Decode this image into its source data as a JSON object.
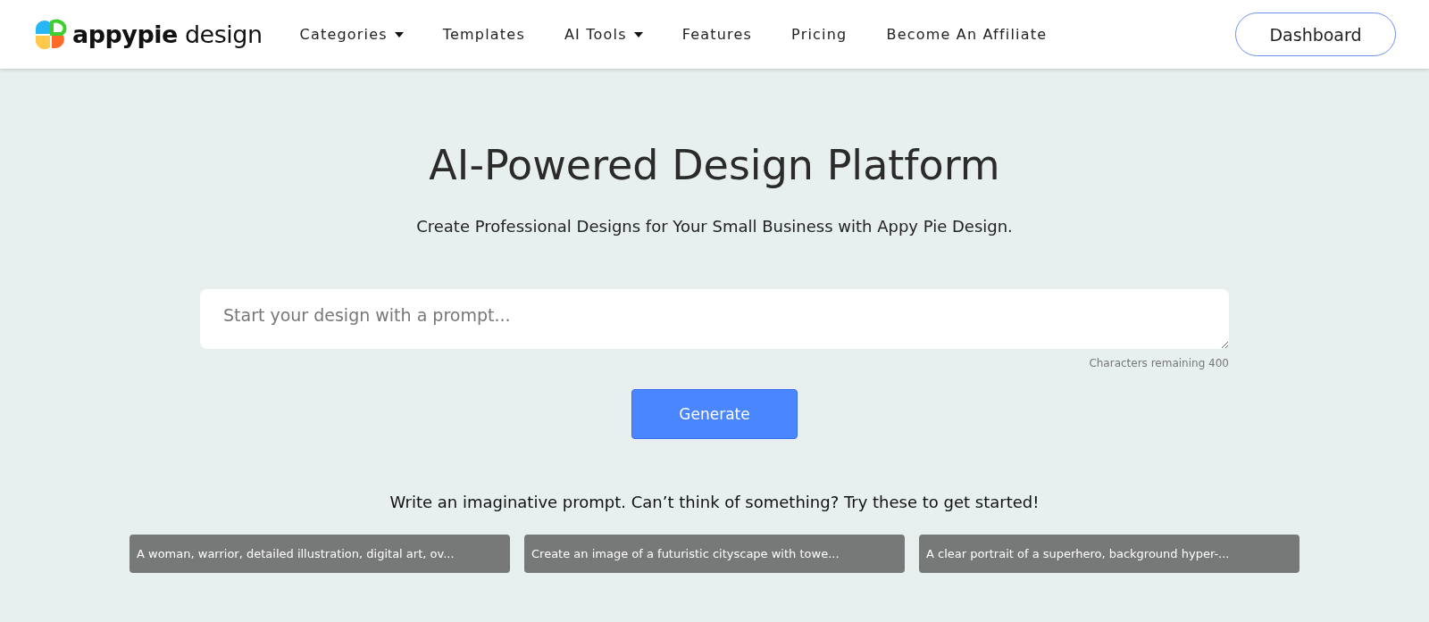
{
  "header": {
    "logo": "**appypie** design",
    "nav": [
      {
        "label": "Categories",
        "dropdown": true
      },
      {
        "label": "Templates",
        "dropdown": false
      },
      {
        "label": "AI Tools",
        "dropdown": true
      },
      {
        "label": "Features",
        "dropdown": false
      },
      {
        "label": "Pricing",
        "dropdown": false
      },
      {
        "label": "Become An Affiliate",
        "dropdown": false
      }
    ],
    "dashboard_button": "Dashboard"
  },
  "hero": {
    "title": "AI-Powered Design Platform",
    "subtitle": "Create Professional Designs for Your Small Business with Appy Pie Design.",
    "prompt": {
      "placeholder": "Start your design with a prompt...",
      "counter": "Characters remaining 400"
    },
    "generate_button": "Generate",
    "suggestion_intro": "Write an imaginative prompt. Can’t think of something? Try these to get started!",
    "suggestions": [
      "A woman, warrior, detailed illustration, digital art, ov...",
      "Create an image of a futuristic cityscape with towe...",
      "A clear portrait of a superhero, background hyper-..."
    ]
  }
}
